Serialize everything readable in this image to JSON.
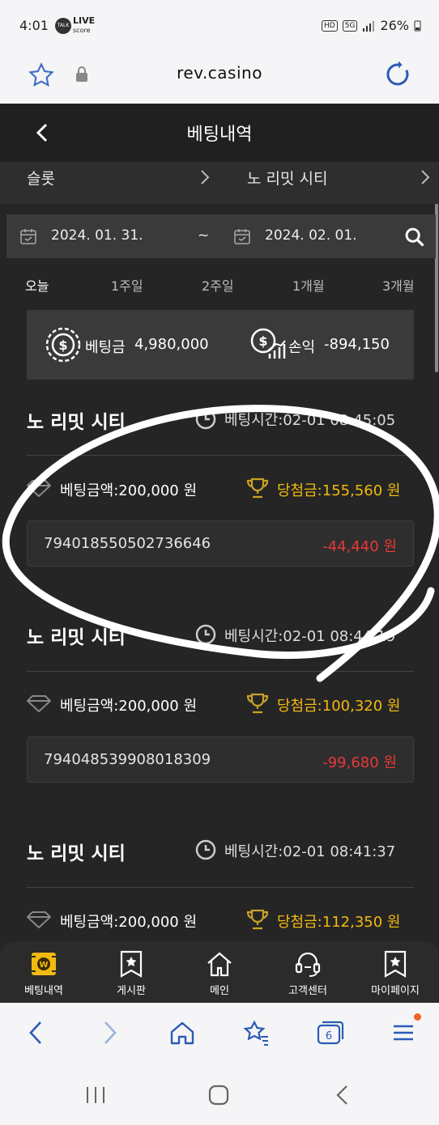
{
  "status": {
    "time": "4:01",
    "hd": "HD",
    "net": "5G",
    "battery": "26%",
    "live": "LIVE",
    "livesub": "score",
    "talk": "TALK"
  },
  "browser": {
    "url": "rev.casino",
    "tab_count": "6"
  },
  "header": {
    "title": "베팅내역"
  },
  "filters": {
    "category": "슬롯",
    "game": "노 리밋 시티"
  },
  "dates": {
    "from": "2024. 01. 31.",
    "sep": "~",
    "to": "2024. 02. 01."
  },
  "periods": [
    "오늘",
    "1주일",
    "2주일",
    "1개월",
    "3개월"
  ],
  "summary": {
    "bet_label": "베팅금",
    "bet_value": "4,980,000",
    "pl_label": "손익",
    "pl_value": "-894,150"
  },
  "records": [
    {
      "title": "노 리밋 시티",
      "time": "베팅시간:02-01 08:45:05",
      "bet": "베팅금액:200,000 원",
      "win": "당첨금:155,560 원",
      "id": "794018550502736646",
      "pl": "-44,440 원"
    },
    {
      "title": "노 리밋 시티",
      "time": "베팅시간:02-01 08:44:19",
      "bet": "베팅금액:200,000 원",
      "win": "당첨금:100,320 원",
      "id": "794048539908018309",
      "pl": "-99,680 원"
    },
    {
      "title": "노 리밋 시티",
      "time": "베팅시간:02-01 08:41:37",
      "bet": "베팅금액:200,000 원",
      "win": "당첨금:112,350 원"
    }
  ],
  "bottom_nav": [
    {
      "label": "베팅내역",
      "icon": "betting-history-icon"
    },
    {
      "label": "게시판",
      "icon": "board-icon"
    },
    {
      "label": "메인",
      "icon": "home-icon"
    },
    {
      "label": "고객센터",
      "icon": "headset-icon"
    },
    {
      "label": "마이페이지",
      "icon": "mypage-icon"
    }
  ],
  "colors": {
    "negative": "#e53935",
    "gold": "#f2b90f",
    "bg": "#252525"
  }
}
